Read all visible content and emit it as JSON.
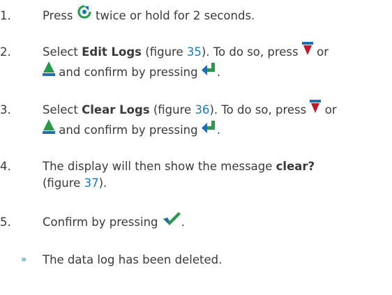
{
  "steps": [
    {
      "number": "1.",
      "t1": "Press",
      "t2": "twice or hold for 2 seconds."
    },
    {
      "number": "2.",
      "t1": "Select ",
      "bold": "Edit Logs",
      "t2": " (figure ",
      "fig": "35",
      "t3": "). To do so, press",
      "t4": "or",
      "t5": "and confirm by pressing",
      "t6": "."
    },
    {
      "number": "3.",
      "t1": "Select ",
      "bold": "Clear Logs",
      "t2": " (figure ",
      "fig": "36",
      "t3": "). To do so, press",
      "t4": "or",
      "t5": "and confirm by pressing",
      "t6": "."
    },
    {
      "number": "4.",
      "t1": "The display will then show the message ",
      "bold": "clear?",
      "t2": "(figure ",
      "fig": "37",
      "t3": ")."
    },
    {
      "number": "5.",
      "t1": "Confirm by pressing",
      "t2": "."
    }
  ],
  "result": {
    "marker": "»",
    "text": "The data log has been deleted."
  },
  "icons": {
    "menu": "menu-key-icon",
    "down": "down-arrow-key-icon",
    "up": "up-arrow-key-icon",
    "enter": "enter-key-icon",
    "confirm": "checkmark-key-icon"
  },
  "colors": {
    "text": "#3a3a3a",
    "link": "#1a7ac0",
    "icon_blue": "#1f6fb0",
    "icon_red": "#c0192c",
    "icon_green": "#2a9a4a"
  }
}
